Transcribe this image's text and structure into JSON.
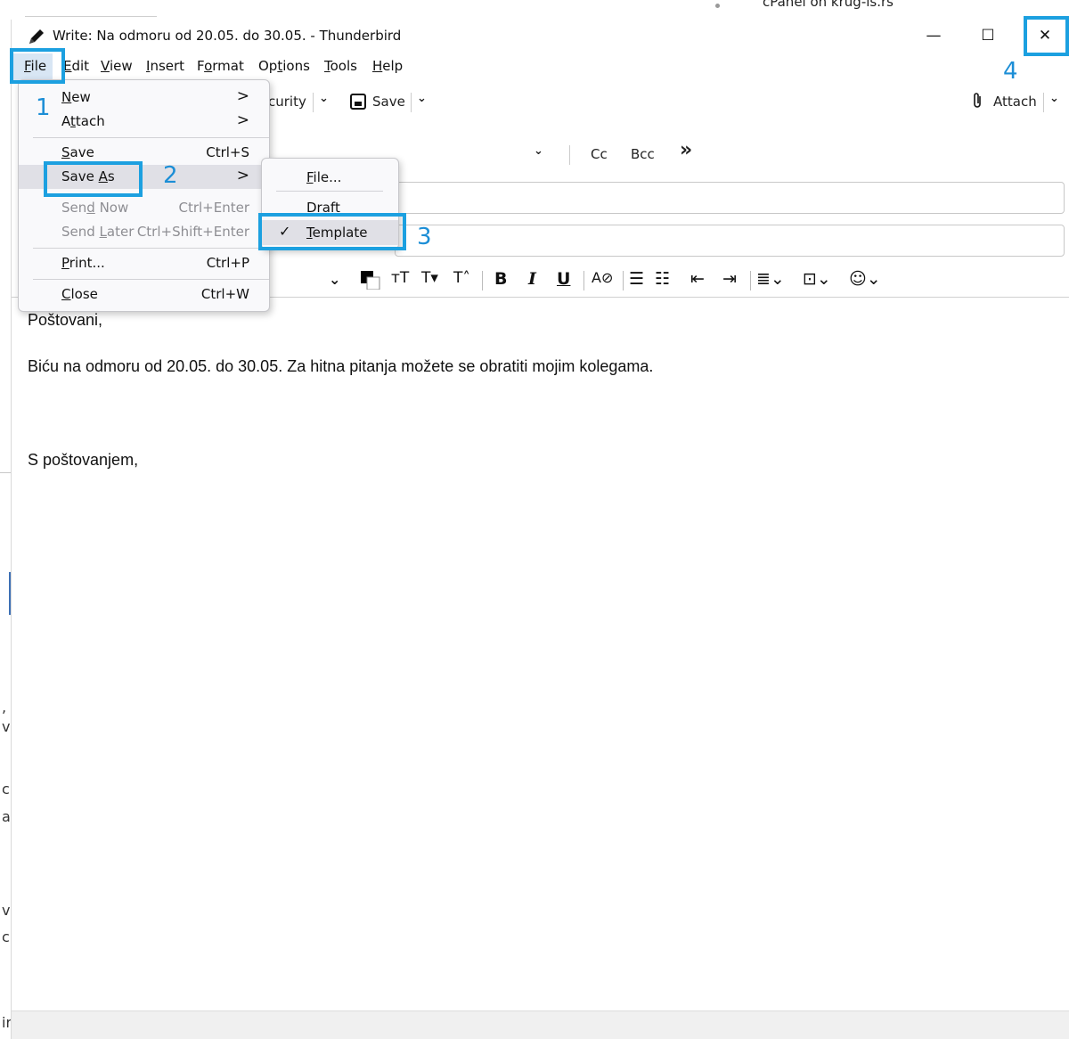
{
  "background": {
    "window_title_fragment": "cPanel on krug-is.rs",
    "side_chars": [
      ",",
      "v",
      "c",
      "a",
      "v",
      "c",
      "ir"
    ]
  },
  "window": {
    "title": "Write: Na odmoru od 20.05. do 30.05. - Thunderbird",
    "controls": {
      "minimize": "—",
      "maximize": "☐",
      "close": "✕"
    }
  },
  "menubar": {
    "items": [
      {
        "label": "File",
        "key": "F",
        "rest": "ile"
      },
      {
        "label": "Edit",
        "key": "E",
        "rest": "dit"
      },
      {
        "label": "View",
        "key": "V",
        "rest": "iew"
      },
      {
        "label": "Insert",
        "key": "I",
        "rest": "nsert"
      },
      {
        "label": "Format",
        "pre": "F",
        "key": "o",
        "rest": "rmat"
      },
      {
        "label": "Options",
        "pre": "Op",
        "key": "t",
        "rest": "ions"
      },
      {
        "label": "Tools",
        "key": "T",
        "rest": "ools"
      },
      {
        "label": "Help",
        "key": "H",
        "rest": "elp"
      }
    ]
  },
  "toolbar": {
    "security_fragment": "curity",
    "save_label": "Save",
    "attach_label": "Attach"
  },
  "header": {
    "cc_label": "Cc",
    "bcc_label": "Bcc",
    "more_label": "»"
  },
  "file_menu": {
    "items": [
      {
        "pre": "",
        "key": "N",
        "rest": "ew",
        "accel": "",
        "submenu": true,
        "disabled": false
      },
      {
        "pre": "A",
        "key": "t",
        "rest": "tach",
        "accel": "",
        "submenu": true,
        "disabled": false
      },
      {
        "pre": "",
        "key": "S",
        "rest": "ave",
        "accel": "Ctrl+S",
        "submenu": false,
        "disabled": false
      },
      {
        "pre": "Save ",
        "key": "A",
        "rest": "s",
        "accel": "",
        "submenu": true,
        "disabled": false
      },
      {
        "pre": "Sen",
        "key": "d",
        "rest": " Now",
        "accel": "Ctrl+Enter",
        "submenu": false,
        "disabled": true
      },
      {
        "pre": "Send ",
        "key": "L",
        "rest": "ater",
        "accel": "Ctrl+Shift+Enter",
        "submenu": false,
        "disabled": true
      },
      {
        "pre": "",
        "key": "P",
        "rest": "rint...",
        "accel": "Ctrl+P",
        "submenu": false,
        "disabled": false
      },
      {
        "pre": "",
        "key": "C",
        "rest": "lose",
        "accel": "Ctrl+W",
        "submenu": false,
        "disabled": false
      }
    ]
  },
  "save_as_submenu": {
    "items": [
      {
        "pre": "",
        "key": "F",
        "rest": "ile...",
        "checked": false
      },
      {
        "pre": "Dra",
        "key": "f",
        "rest": "t",
        "checked": false
      },
      {
        "pre": "",
        "key": "T",
        "rest": "emplate",
        "checked": true
      }
    ]
  },
  "message_body": {
    "lines": [
      "Poštovani,",
      "Biću na odmoru od 20.05. do 30.05. Za hitna pitanja možete se obratiti mojim kolegama.",
      "S poštovanjem,"
    ]
  },
  "annotations": {
    "labels": [
      "1",
      "2",
      "3",
      "4"
    ],
    "color": "#1ca0e0"
  },
  "colors": {
    "menu_bg": "#f9f9fb",
    "menu_hover": "#e0e0e6",
    "disabled_text": "#8e8e93",
    "file_menu_active": "#d8e6f4"
  }
}
